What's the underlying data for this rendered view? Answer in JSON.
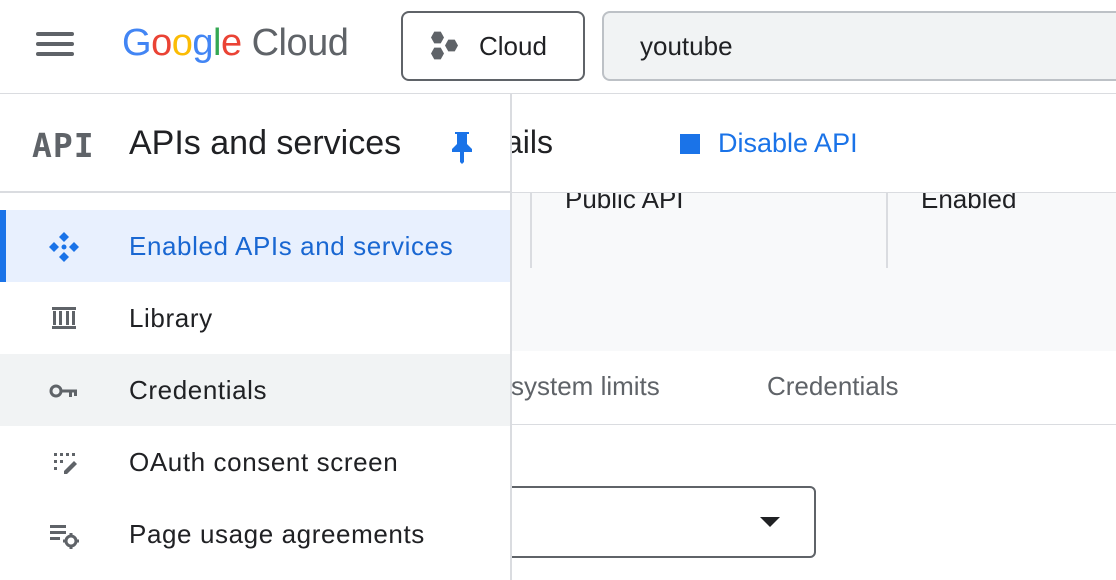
{
  "topbar": {
    "brand_google": [
      "G",
      "o",
      "o",
      "g",
      "l",
      "e"
    ],
    "brand_cloud": "Cloud",
    "project_label": "Cloud",
    "search_value": "youtube"
  },
  "main": {
    "details_title_fragment": "ails",
    "disable_button_label": "Disable API",
    "info_values": [
      "Public API",
      "Enabled"
    ],
    "tabs": [
      "system limits",
      "Credentials"
    ]
  },
  "sidenav": {
    "logo_text": "API",
    "title": "APIs and services",
    "items": [
      {
        "label": "Enabled APIs and services",
        "icon": "enabled-apis-icon",
        "state": "active"
      },
      {
        "label": "Library",
        "icon": "library-icon",
        "state": "normal"
      },
      {
        "label": "Credentials",
        "icon": "key-icon",
        "state": "hover"
      },
      {
        "label": "OAuth consent screen",
        "icon": "oauth-consent-icon",
        "state": "normal"
      },
      {
        "label": "Page usage agreements",
        "icon": "page-usage-icon",
        "state": "normal"
      }
    ]
  },
  "colors": {
    "accent": "#1a73e8",
    "active_bg": "#e8f0fe",
    "hover_bg": "#f1f3f4",
    "icon_gray": "#5f6368"
  }
}
